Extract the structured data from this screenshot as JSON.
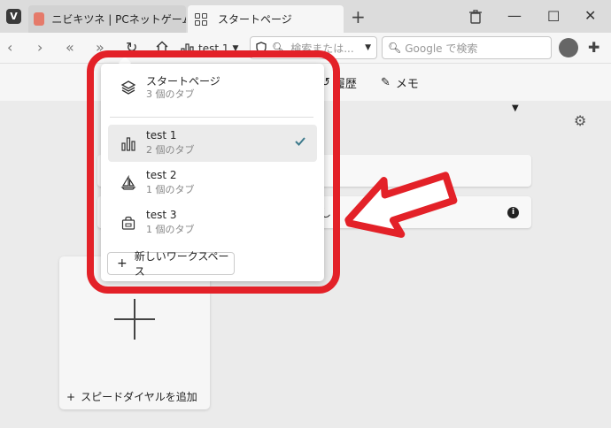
{
  "tabs": [
    {
      "label": "ニビキツネ | PCネットゲーム漫画"
    },
    {
      "label": "スタートページ"
    }
  ],
  "navbar": {
    "workspace_label": "test 1",
    "url_placeholder": "検索または...",
    "search_placeholder": "Google で検索"
  },
  "subbar": {
    "history_label": "履歴",
    "notes_label": "メモ"
  },
  "workspace_menu": {
    "items": [
      {
        "name": "スタートページ",
        "count": "3 個のタブ",
        "icon": "layers-icon"
      },
      {
        "name": "test 1",
        "count": "2 個のタブ",
        "icon": "bar-chart-icon",
        "selected": true
      },
      {
        "name": "test 2",
        "count": "1 個のタブ",
        "icon": "sailboat-icon"
      },
      {
        "name": "test 3",
        "count": "1 個のタブ",
        "icon": "shopping-bag-icon"
      }
    ],
    "new_workspace_label": "新しいワークスペース"
  },
  "background_partial": {
    "row_fragment": "し"
  },
  "speed_dial": {
    "add_label": "スピードダイヤルを追加"
  },
  "colors": {
    "highlight_red": "#e32128",
    "check_color": "#3d7a8c"
  }
}
